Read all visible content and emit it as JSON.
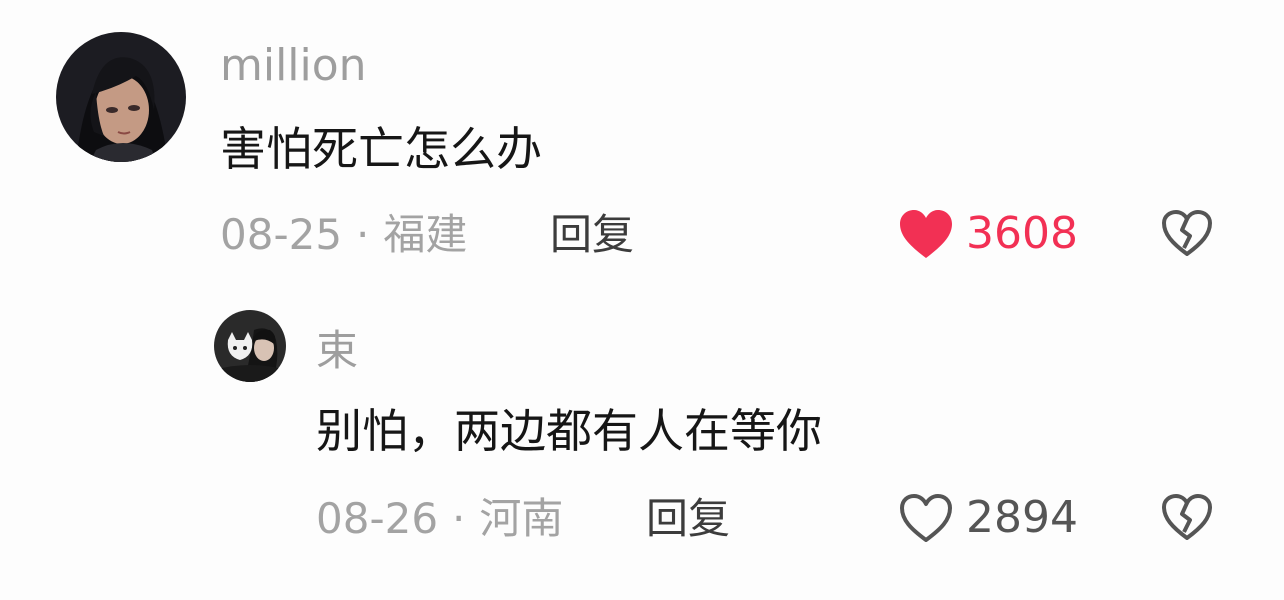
{
  "comments": [
    {
      "username": "million",
      "text": "害怕死亡怎么办",
      "date": "08-25",
      "separator": "·",
      "location": "福建",
      "reply_label": "回复",
      "likes": "3608",
      "liked": true,
      "like_color": "#f23054",
      "avatar_icon": "anime-portrait-avatar"
    },
    {
      "username": "束",
      "text": "别怕，两边都有人在等你",
      "date": "08-26",
      "separator": "·",
      "location": "河南",
      "reply_label": "回复",
      "likes": "2894",
      "liked": false,
      "like_color": "#555555",
      "avatar_icon": "person-with-cat-avatar"
    }
  ]
}
